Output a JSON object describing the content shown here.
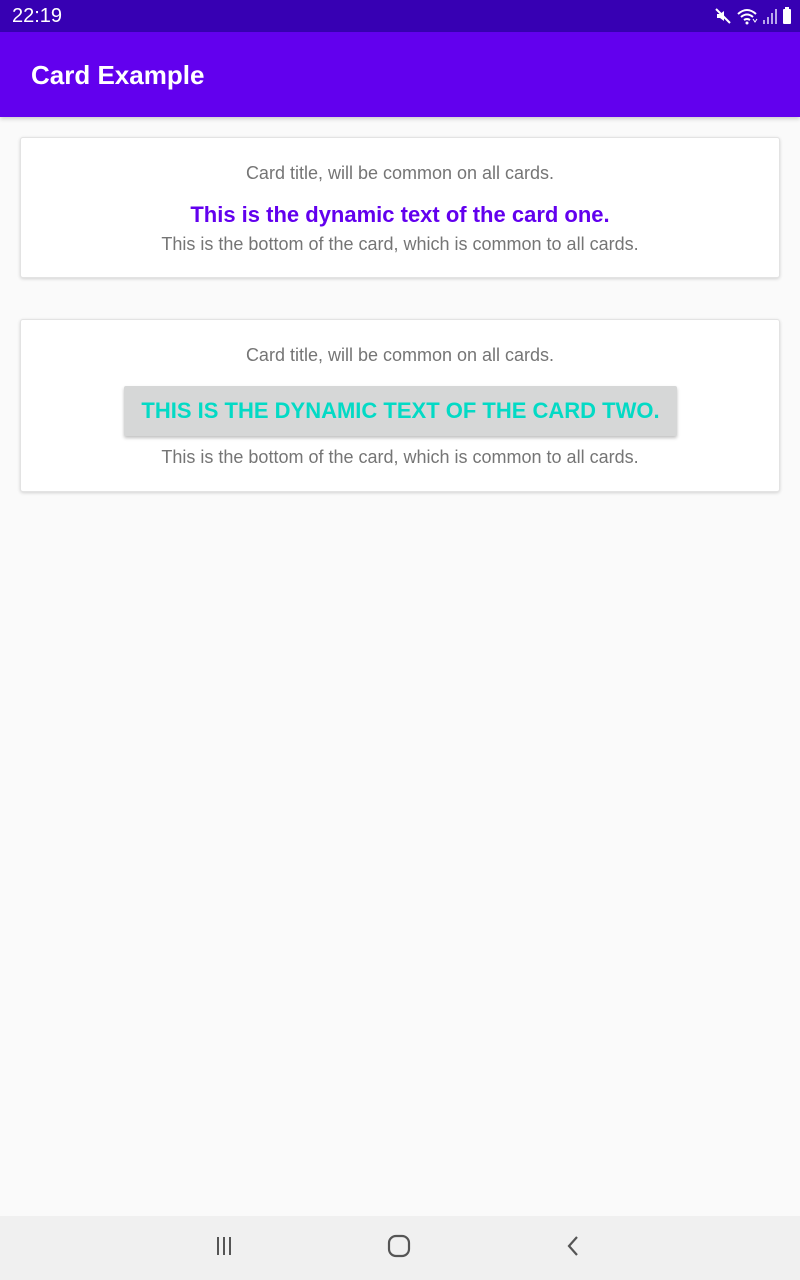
{
  "status_bar": {
    "time": "22:19",
    "icons": [
      "mute-icon",
      "wifi-icon",
      "signal-icon",
      "battery-icon"
    ]
  },
  "app_bar": {
    "title": "Card Example",
    "color": "#6200ee"
  },
  "cards": [
    {
      "title": "Card title, will be common on all cards.",
      "dynamic_text": "This is the dynamic text of the card one.",
      "bottom": "This is the bottom of the card, which is common to all cards."
    },
    {
      "title": "Card title, will be common on all cards.",
      "dynamic_text": "THIS IS THE DYNAMIC TEXT OF THE CARD TWO.",
      "bottom": "This is the bottom of the card, which is common to all cards."
    }
  ],
  "nav_bar": {
    "buttons": [
      "recent-apps-icon",
      "home-icon",
      "back-icon"
    ]
  },
  "colors": {
    "status_bar": "#3700b3",
    "primary": "#6200ee",
    "accent": "#03dac5",
    "secondary_text": "#757575",
    "background": "#fafafa"
  }
}
